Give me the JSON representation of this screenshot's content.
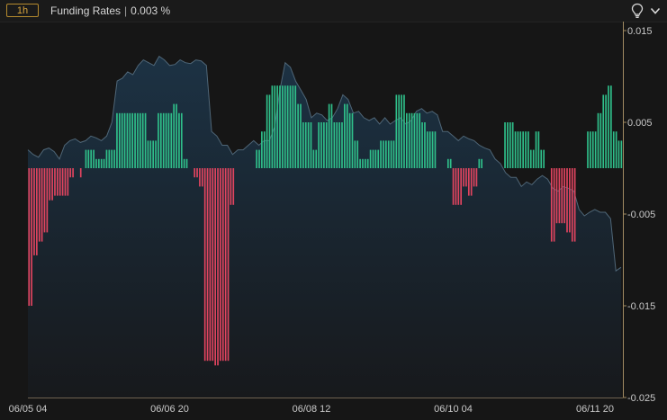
{
  "header": {
    "timeframe_label": "1h",
    "title": "Funding Rates",
    "value_text": "0.003 %"
  },
  "icons": [
    "lightbulb-icon",
    "chevron-down-icon"
  ],
  "colors": {
    "background": "#161616",
    "positive_bar": "#2fbf8a",
    "negative_bar": "#e0445f",
    "area_fill": "#1a2b3a",
    "area_line": "#4f6677",
    "axis": "#a08a62"
  },
  "chart_data": {
    "type": "bar",
    "title": "Funding Rates",
    "ylim": [
      -0.025,
      0.015
    ],
    "y_ticks": [
      "0.015",
      "0.005",
      "-0.005",
      "-0.015",
      "-0.025"
    ],
    "y_tick_values": [
      0.015,
      0.005,
      -0.005,
      -0.015,
      -0.025
    ],
    "x_tick_labels": [
      "06/05 04",
      "06/06 20",
      "06/08 12",
      "06/10 04",
      "06/11 20"
    ],
    "grid": false,
    "series": [
      {
        "type": "bar",
        "values": [
          -0.015,
          -0.015,
          -0.0095,
          -0.0095,
          -0.008,
          -0.008,
          -0.007,
          -0.007,
          -0.0035,
          -0.0035,
          -0.003,
          -0.003,
          -0.003,
          -0.003,
          -0.003,
          -0.003,
          -0.001,
          -0.001,
          null,
          null,
          -0.001,
          null,
          0.002,
          0.002,
          0.002,
          0.002,
          0.001,
          0.001,
          0.001,
          0.001,
          0.002,
          0.002,
          0.002,
          0.002,
          0.006,
          0.006,
          0.006,
          0.006,
          0.006,
          0.006,
          0.006,
          0.006,
          0.006,
          0.006,
          0.006,
          0.006,
          0.003,
          0.003,
          0.003,
          0.003,
          0.006,
          0.006,
          0.006,
          0.006,
          0.006,
          0.006,
          0.007,
          0.007,
          0.006,
          0.006,
          0.001,
          0.001,
          null,
          null,
          -0.001,
          -0.001,
          -0.002,
          -0.002,
          -0.021,
          -0.021,
          -0.021,
          -0.021,
          -0.0215,
          -0.0215,
          -0.021,
          -0.021,
          -0.021,
          -0.021,
          -0.004,
          -0.004,
          null,
          null,
          null,
          null,
          null,
          null,
          null,
          null,
          0.002,
          0.002,
          0.004,
          0.004,
          0.008,
          0.008,
          0.009,
          0.009,
          0.009,
          0.009,
          0.009,
          0.009,
          0.009,
          0.009,
          0.009,
          0.009,
          0.007,
          0.007,
          0.005,
          0.005,
          0.005,
          0.005,
          0.002,
          0.002,
          0.005,
          0.005,
          0.005,
          0.005,
          0.007,
          0.007,
          0.005,
          0.005,
          0.005,
          0.005,
          0.007,
          0.007,
          0.006,
          0.006,
          0.003,
          0.003,
          0.001,
          0.001,
          0.001,
          0.001,
          0.002,
          0.002,
          0.002,
          0.002,
          0.003,
          0.003,
          0.003,
          0.003,
          0.003,
          0.003,
          0.008,
          0.008,
          0.008,
          0.008,
          0.006,
          0.006,
          0.006,
          0.006,
          0.006,
          0.006,
          0.005,
          0.005,
          0.004,
          0.004,
          0.004,
          0.004,
          null,
          null,
          null,
          null,
          0.001,
          0.001,
          -0.004,
          -0.004,
          -0.004,
          -0.004,
          -0.002,
          -0.002,
          -0.003,
          -0.003,
          -0.002,
          -0.002,
          0.001,
          0.001,
          null,
          null,
          null,
          null,
          null,
          null,
          null,
          null,
          0.005,
          0.005,
          0.005,
          0.005,
          0.004,
          0.004,
          0.004,
          0.004,
          0.004,
          0.004,
          0.002,
          0.002,
          0.004,
          0.004,
          0.002,
          0.002,
          null,
          null,
          -0.008,
          -0.008,
          -0.006,
          -0.006,
          -0.006,
          -0.006,
          -0.007,
          -0.007,
          -0.008,
          -0.008,
          null,
          null,
          null,
          null,
          0.004,
          0.004,
          0.004,
          0.004,
          0.006,
          0.006,
          0.008,
          0.008,
          0.009,
          0.009,
          0.004,
          0.004,
          0.003,
          0.003
        ]
      },
      {
        "type": "area",
        "values": [
          0.002,
          0.0015,
          0.0012,
          0.002,
          0.0022,
          0.0018,
          0.001,
          0.0025,
          0.003,
          0.0032,
          0.0028,
          0.003,
          0.0035,
          0.0033,
          0.003,
          0.0035,
          0.005,
          0.0095,
          0.0098,
          0.0105,
          0.0102,
          0.0112,
          0.0118,
          0.0115,
          0.0112,
          0.0122,
          0.0118,
          0.0112,
          0.0113,
          0.0118,
          0.0115,
          0.0114,
          0.0118,
          0.0117,
          0.0112,
          0.004,
          0.0035,
          0.0025,
          0.0025,
          0.0015,
          0.002,
          0.002,
          0.0025,
          0.003,
          0.0025,
          0.003,
          0.003,
          0.0045,
          0.0085,
          0.0115,
          0.011,
          0.0095,
          0.0085,
          0.0075,
          0.0055,
          0.006,
          0.0058,
          0.0052,
          0.0055,
          0.0065,
          0.008,
          0.0075,
          0.006,
          0.0062,
          0.0055,
          0.0052,
          0.0055,
          0.0048,
          0.0055,
          0.0048,
          0.0052,
          0.0055,
          0.0048,
          0.0052,
          0.0062,
          0.0065,
          0.006,
          0.0062,
          0.0058,
          0.004,
          0.004,
          0.0035,
          0.003,
          0.0035,
          0.0032,
          0.003,
          0.0025,
          0.0022,
          0.002,
          0.001,
          0.0005,
          -0.0005,
          -0.001,
          -0.001,
          -0.002,
          -0.0015,
          -0.0018,
          -0.0012,
          -0.0008,
          -0.0012,
          -0.0022,
          -0.0025,
          -0.002,
          -0.0022,
          -0.0025,
          -0.0045,
          -0.0052,
          -0.0048,
          -0.0045,
          -0.0048,
          -0.0048,
          -0.0055,
          -0.0112,
          -0.0108
        ]
      }
    ]
  }
}
